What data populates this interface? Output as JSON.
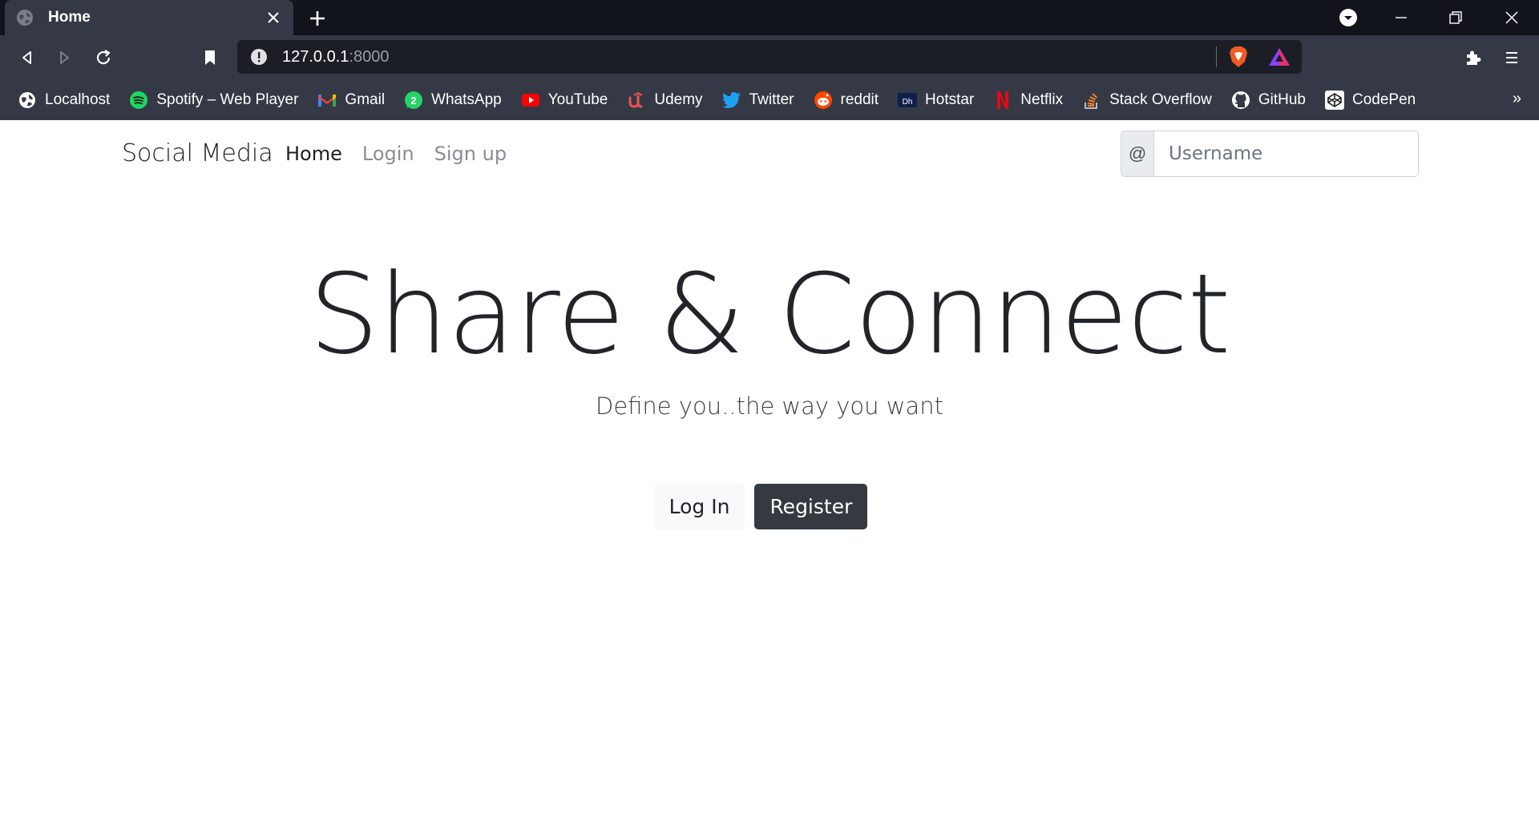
{
  "browser": {
    "tab": {
      "title": "Home",
      "favicon": "globe-icon"
    },
    "url": {
      "host": "127.0.0.1",
      "port": ":8000"
    },
    "bookmarks": [
      {
        "label": "Localhost",
        "icon": "globe-icon"
      },
      {
        "label": "Spotify – Web Player",
        "icon": "spotify-icon"
      },
      {
        "label": "Gmail",
        "icon": "gmail-icon"
      },
      {
        "label": "WhatsApp",
        "icon": "whatsapp-icon",
        "badge": "2"
      },
      {
        "label": "YouTube",
        "icon": "youtube-icon"
      },
      {
        "label": "Udemy",
        "icon": "udemy-icon"
      },
      {
        "label": "Twitter",
        "icon": "twitter-icon"
      },
      {
        "label": "reddit",
        "icon": "reddit-icon"
      },
      {
        "label": "Hotstar",
        "icon": "hotstar-icon"
      },
      {
        "label": "Netflix",
        "icon": "netflix-icon"
      },
      {
        "label": "Stack Overflow",
        "icon": "stackoverflow-icon"
      },
      {
        "label": "GitHub",
        "icon": "github-icon"
      },
      {
        "label": "CodePen",
        "icon": "codepen-icon"
      }
    ],
    "bookmarks_more": "»"
  },
  "navbar": {
    "brand": "Social Media",
    "links": [
      "Home",
      "Login",
      "Sign up"
    ],
    "username_prefix": "@",
    "username_placeholder": "Username"
  },
  "hero": {
    "title": "Share & Connect",
    "subtitle": "Define you..the way you want",
    "login_button": "Log In",
    "register_button": "Register"
  }
}
